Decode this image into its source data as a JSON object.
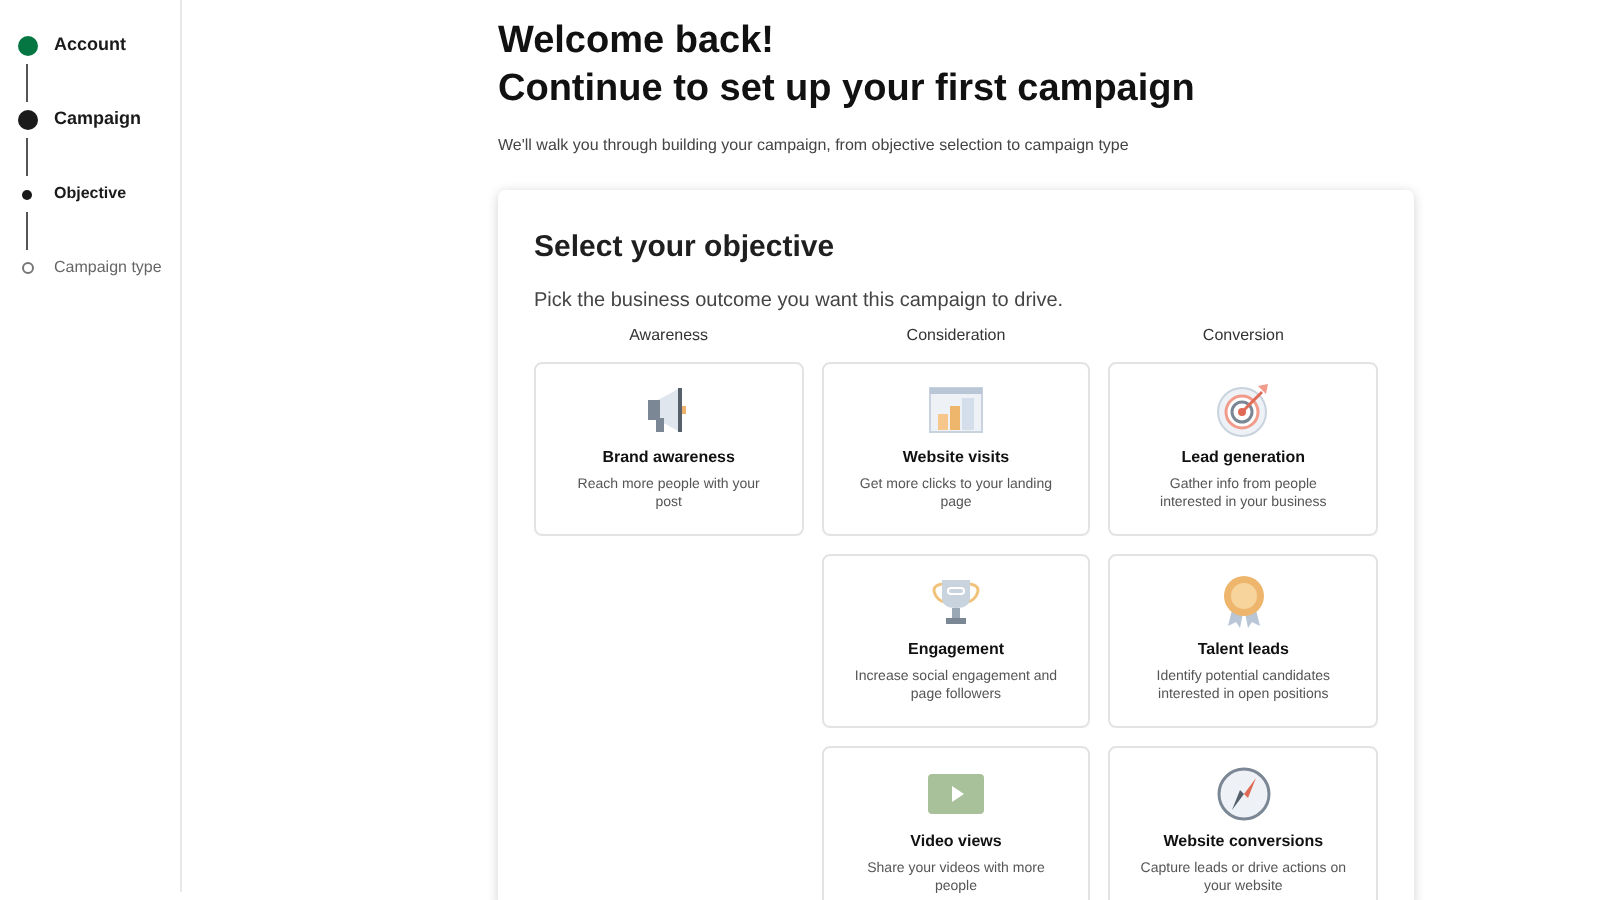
{
  "steps": [
    {
      "label": "Account",
      "completed": true,
      "current": false
    },
    {
      "label": "Campaign",
      "completed": false,
      "current": true,
      "children": [
        {
          "label": "Objective",
          "current": true
        },
        {
          "label": "Campaign type",
          "current": false
        }
      ]
    }
  ],
  "heading_lines": [
    "Welcome back!",
    "Continue to set up your first campaign"
  ],
  "intro": "We'll walk you through building your campaign, from objective selection to campaign type",
  "panel": {
    "title": "Select your objective",
    "subtitle": "Pick the business outcome you want this campaign to drive.",
    "columns": [
      {
        "heading": "Awareness",
        "cards": [
          {
            "title": "Brand awareness",
            "description": "Reach more people with your post"
          }
        ]
      },
      {
        "heading": "Consideration",
        "cards": [
          {
            "title": "Website visits",
            "description": "Get more clicks to your landing page"
          },
          {
            "title": "Engagement",
            "description": "Increase social engagement and page followers"
          },
          {
            "title": "Video views",
            "description": "Share your videos with more people"
          }
        ]
      },
      {
        "heading": "Conversion",
        "cards": [
          {
            "title": "Lead generation",
            "description": "Gather info from people interested in your business"
          },
          {
            "title": "Talent leads",
            "description": "Identify potential candidates interested in open positions"
          },
          {
            "title": "Website conversions",
            "description": "Capture leads or drive actions on your website"
          }
        ]
      }
    ]
  }
}
